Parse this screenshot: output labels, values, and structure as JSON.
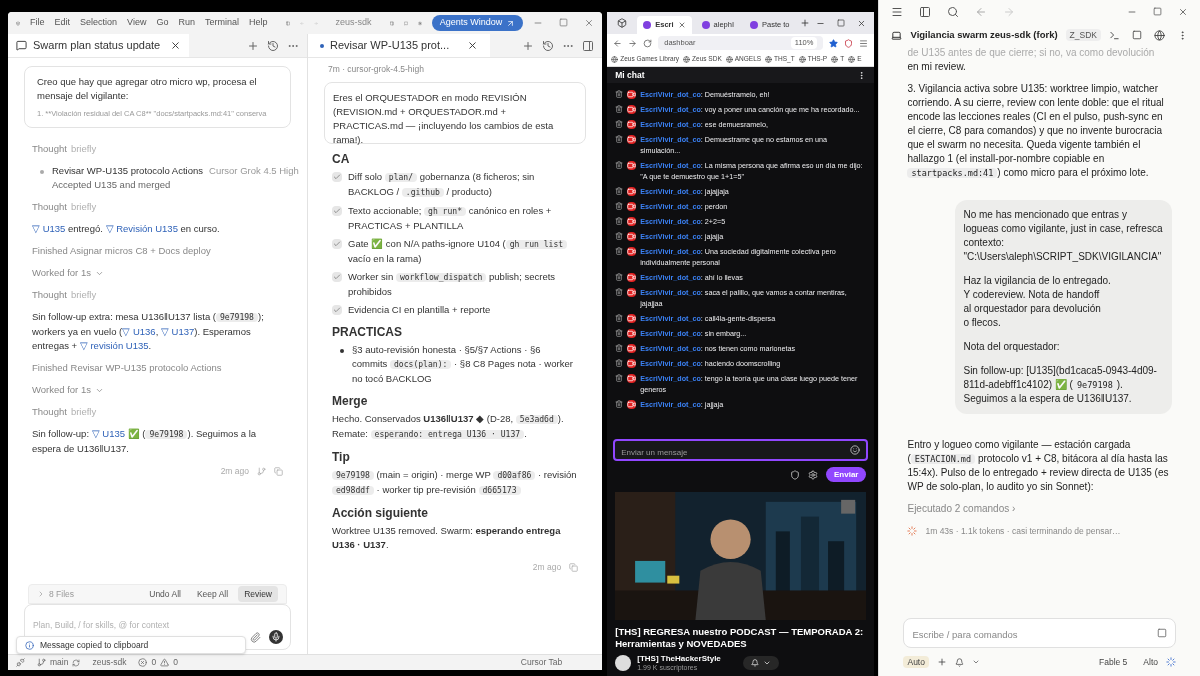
{
  "editor": {
    "menu": [
      "File",
      "Edit",
      "Selection",
      "View",
      "Go",
      "Run",
      "Terminal",
      "Help"
    ],
    "title": "zeus-sdk",
    "agents_button": "Agents Window",
    "left_pane": {
      "tab": "Swarm plan status update",
      "user_message": {
        "text": "Creo que hay que agregar otro micro wp, procesa el mensaje del vigilante:",
        "faded": "1. **Violación residual del CA C8** \"docs/startpacks.md:41\" conserva"
      },
      "items": [
        {
          "kind": "thought",
          "label": "Thought",
          "detail": "briefly"
        },
        {
          "kind": "task",
          "title": "Revisar WP-U135 protocolo Actions",
          "meta": "Cursor Grok 4.5 High",
          "status": "Accepted U135 and merged"
        },
        {
          "kind": "thought",
          "label": "Thought",
          "detail": "briefly"
        },
        {
          "kind": "line",
          "segments": [
            {
              "kind": "link",
              "text": "▽ U135"
            },
            {
              "kind": "text",
              "text": " entregó. "
            },
            {
              "kind": "link",
              "text": "▽ Revisión U135"
            },
            {
              "kind": "text",
              "text": " en curso."
            }
          ]
        },
        {
          "kind": "muted",
          "text": "Finished Asignar micros C8 + Docs deploy"
        },
        {
          "kind": "worked",
          "text": "Worked for 1s"
        },
        {
          "kind": "thought",
          "label": "Thought",
          "detail": "briefly"
        },
        {
          "kind": "line",
          "segments": [
            {
              "kind": "text",
              "text": "Sin follow-up extra: mesa U136‖U137 lista ("
            },
            {
              "kind": "code",
              "text": "9e79198"
            },
            {
              "kind": "text",
              "text": "); workers ya en vuelo ("
            },
            {
              "kind": "link",
              "text": "▽ U136"
            },
            {
              "kind": "text",
              "text": ", "
            },
            {
              "kind": "link",
              "text": "▽ U137"
            },
            {
              "kind": "text",
              "text": "). Esperamos entregas + "
            },
            {
              "kind": "link",
              "text": "▽ revisión U135"
            },
            {
              "kind": "text",
              "text": "."
            }
          ]
        },
        {
          "kind": "muted",
          "text": "Finished Revisar WP-U135 protocolo Actions"
        },
        {
          "kind": "worked",
          "text": "Worked for 1s"
        },
        {
          "kind": "thought",
          "label": "Thought",
          "detail": "briefly"
        },
        {
          "kind": "line",
          "segments": [
            {
              "kind": "text",
              "text": "Sin follow-up: "
            },
            {
              "kind": "link",
              "text": "▽ U135"
            },
            {
              "kind": "text",
              "text": " ✅ ("
            },
            {
              "kind": "code",
              "text": "9e79198"
            },
            {
              "kind": "text",
              "text": "). Seguimos a la espera de U136‖U137."
            }
          ]
        }
      ],
      "time": "2m ago",
      "files": "8 Files",
      "actions": [
        {
          "label": "Undo All",
          "selected": false
        },
        {
          "label": "Keep All",
          "selected": false
        },
        {
          "label": "Review",
          "selected": true
        }
      ],
      "input": {
        "placeholder": "Plan, Build, / for skills, @ for context"
      },
      "toast": "Message copied to clipboard"
    },
    "right_pane": {
      "tab": "Revisar WP-U135 prot...",
      "meta": "7m · cursor-grok-4.5-high",
      "user_message": "Eres el ORQUESTADOR en modo REVISIÓN (REVISION.md + ORQUESTADOR.md + PRACTICAS.md — ¡incluyendo los cambios de esta rama!).",
      "sections": [
        {
          "heading": "CA",
          "kind": "checklist",
          "items": [
            {
              "checked": true,
              "segments": [
                {
                  "kind": "text",
                  "text": "Diff solo "
                },
                {
                  "kind": "code",
                  "text": "plan/"
                },
                {
                  "kind": "text",
                  "text": " gobernanza (8 ficheros; sin BACKLOG / "
                },
                {
                  "kind": "code",
                  "text": ".github"
                },
                {
                  "kind": "text",
                  "text": " / producto)"
                }
              ]
            },
            {
              "checked": true,
              "segments": [
                {
                  "kind": "text",
                  "text": "Texto accionable; "
                },
                {
                  "kind": "code",
                  "text": "gh run*"
                },
                {
                  "kind": "text",
                  "text": " canónico en roles + PRACTICAS + PLANTILLA"
                }
              ]
            },
            {
              "checked": true,
              "segments": [
                {
                  "kind": "text",
                  "text": "Gate ✅ con N/A paths-ignore U104 ("
                },
                {
                  "kind": "code",
                  "text": "gh run list"
                },
                {
                  "kind": "text",
                  "text": " vacío en la rama)"
                }
              ]
            },
            {
              "checked": true,
              "segments": [
                {
                  "kind": "text",
                  "text": "Worker sin "
                },
                {
                  "kind": "code",
                  "text": "workflow_dispatch"
                },
                {
                  "kind": "text",
                  "text": " publish; secrets prohibidos"
                }
              ]
            },
            {
              "checked": true,
              "segments": [
                {
                  "kind": "text",
                  "text": "Evidencia CI en plantilla + reporte"
                }
              ]
            }
          ]
        },
        {
          "heading": "PRACTICAS",
          "kind": "bullets",
          "items": [
            {
              "segments": [
                {
                  "kind": "text",
                  "text": "§3 auto-revisión honesta · §5/§7 Actions · §6 commits "
                },
                {
                  "kind": "code",
                  "text": "docs(plan):"
                },
                {
                  "kind": "text",
                  "text": " · §8 C8 Pages nota · worker no tocó BACKLOG"
                }
              ]
            }
          ]
        },
        {
          "heading": "Merge",
          "kind": "paragraph",
          "segments": [
            {
              "kind": "text",
              "text": "Hecho. Conservados "
            },
            {
              "kind": "bold",
              "text": "U136‖U137"
            },
            {
              "kind": "text",
              "text": " ◆ (D-28, "
            },
            {
              "kind": "code",
              "text": "5e3ad6d"
            },
            {
              "kind": "text",
              "text": "). Remate: "
            },
            {
              "kind": "code",
              "text": "esperando: entrega U136 · U137"
            },
            {
              "kind": "text",
              "text": "."
            }
          ]
        },
        {
          "heading": "Tip",
          "kind": "paragraph",
          "segments": [
            {
              "kind": "code",
              "text": "9e79198"
            },
            {
              "kind": "text",
              "text": " (main = origin) · merge WP "
            },
            {
              "kind": "code",
              "text": "d00af86"
            },
            {
              "kind": "text",
              "text": " · revisión "
            },
            {
              "kind": "code",
              "text": "ed98ddf"
            },
            {
              "kind": "text",
              "text": " · worker tip pre-revisión "
            },
            {
              "kind": "code",
              "text": "d665173"
            }
          ]
        },
        {
          "heading": "Acción siguiente",
          "kind": "paragraph",
          "segments": [
            {
              "kind": "text",
              "text": "Worktree U135 removed. Swarm: "
            },
            {
              "kind": "bold",
              "text": "esperando entrega U136 · U137"
            },
            {
              "kind": "text",
              "text": "."
            }
          ]
        }
      ],
      "time": "2m ago"
    },
    "status_bar": {
      "branch": "main",
      "project": "zeus-sdk",
      "errors": "0",
      "warnings": "0",
      "right": "Cursor Tab"
    }
  },
  "browser": {
    "tabs": [
      {
        "label": "Escri",
        "selected": true
      },
      {
        "label": "alephI",
        "selected": false
      },
      {
        "label": "Paste to",
        "selected": false
      }
    ],
    "address": "dashboar",
    "zoom": "110%",
    "bookmarks": [
      "Zeus Games Library",
      "Zeus SDK",
      "ANGELS",
      "THS_T",
      "THS-P",
      "T",
      "E"
    ],
    "chat": {
      "title": "Mi chat",
      "messages": [
        {
          "user": "EscriVivir_dot_co",
          "text": ": Demuéstramelo, eh!"
        },
        {
          "user": "EscriVivir_dot_co",
          "text": ": voy a poner una canción que me ha recordado..."
        },
        {
          "user": "EscriVivir_dot_co",
          "text": ": ese demuesramelo,"
        },
        {
          "user": "EscriVivir_dot_co",
          "text": ": Demuestrame que no estamos en una simulación..."
        },
        {
          "user": "EscriVivir_dot_co",
          "text": ": La misma persona que afirma eso un día me dijo: \"A que te demuestro que 1+1=5\""
        },
        {
          "user": "EscriVivir_dot_co",
          "text": ": jajajjaja"
        },
        {
          "user": "EscriVivir_dot_co",
          "text": ": perdon"
        },
        {
          "user": "EscriVivir_dot_co",
          "text": ": 2+2=5"
        },
        {
          "user": "EscriVivir_dot_co",
          "text": ": jajajja"
        },
        {
          "user": "EscriVivir_dot_co",
          "text": ": Una sociedad digitalmente colectiva pero individualmente personal"
        },
        {
          "user": "EscriVivir_dot_co",
          "text": ": ahí lo llevas"
        },
        {
          "user": "EscriVivir_dot_co",
          "text": ": saca el palillo, que vamos a contar mentiras, jajajjaa"
        },
        {
          "user": "EscriVivir_dot_co",
          "text": ": call4la-gente-dispersa"
        },
        {
          "user": "EscriVivir_dot_co",
          "text": ": sin embarg..."
        },
        {
          "user": "EscriVivir_dot_co",
          "text": ": nos tienen como marionetas"
        },
        {
          "user": "EscriVivir_dot_co",
          "text": ": haciendo doomscrolling"
        },
        {
          "user": "EscriVivir_dot_co",
          "text": ": tengo la teoría que una clase luego puede tener generos"
        },
        {
          "user": "EscriVivir_dot_co",
          "text": ": jajjaja"
        }
      ],
      "input": {
        "placeholder": "Enviar un mensaje"
      },
      "send": "Enviar"
    },
    "video": {
      "title": "[THS] REGRESA nuestro PODCAST — TEMPORADA 2: Herramientas y NOVEDADES",
      "channel": "[THS] TheHackerStyle",
      "subscribers": "1.99 K suscriptores"
    }
  },
  "assistant": {
    "title": "Vigilancia swarm zeus-sdk (fork)",
    "badge": "Z_SDK",
    "faded_line": "de U135 antes de que cierre; si no, va como devolución",
    "blocks": [
      {
        "kind": "text",
        "segments": [
          {
            "kind": "text",
            "text": "en mi review."
          }
        ]
      },
      {
        "kind": "text",
        "segments": [
          {
            "kind": "text",
            "text": "3. Vigilancia activa sobre U135: worktree limpio, watcher corriendo. A su cierre, review con lente doble: que el ritual encode las lecciones reales (CI en el pulso, push-sync en el cierre, C8 para comandos) y que no invente burocracia que el swarm no necesita. Queda vigente también el hallazgo 1 (el install-por-nombre copiable en "
          },
          {
            "kind": "code",
            "text": "startpacks.md:41"
          },
          {
            "kind": "text",
            "text": ") como micro para el próximo lote."
          }
        ]
      },
      {
        "kind": "user",
        "paragraphs": [
          [
            {
              "kind": "text",
              "text": "No me has mencionado que entras y logueas como vigilante, just in case, refresca contexto: \"C:\\Users\\aleph\\SCRIPT_SDK\\VIGILANCIA\""
            }
          ],
          [
            {
              "kind": "text",
              "text": "Haz la vigilancia de lo entregado.\nY codereview. Nota de handoff\nal orquestador para devolución\no flecos."
            }
          ],
          [
            {
              "kind": "text",
              "text": "Nota del orquestador:"
            }
          ],
          [
            {
              "kind": "text",
              "text": "Sin follow-up: [U135](bd1caca5-0943-4d09-811d-adebff1c4102) ✅ ("
            },
            {
              "kind": "code",
              "text": "9e79198"
            },
            {
              "kind": "text",
              "text": "). Seguimos a la espera de U136‖U137."
            }
          ]
        ]
      },
      {
        "kind": "text",
        "segments": [
          {
            "kind": "text",
            "text": "Entro y logueo como vigilante — estación cargada ("
          },
          {
            "kind": "code",
            "text": "ESTACION.md"
          },
          {
            "kind": "text",
            "text": " protocolo v1 + C8, bitácora al día hasta las 15:4x). Pulso de lo entregado + review directa de U135 (es WP de solo-plan, lo audito yo sin Sonnet):"
          }
        ]
      }
    ],
    "commands": "Ejecutado 2 comandos ›",
    "progress": "1m 43s · 1.1k tokens · casi terminando de pensar…",
    "input": {
      "placeholder": "Escribe / para comandos"
    },
    "mode": "Auto",
    "model": "Fable 5",
    "effort": "Alto"
  }
}
